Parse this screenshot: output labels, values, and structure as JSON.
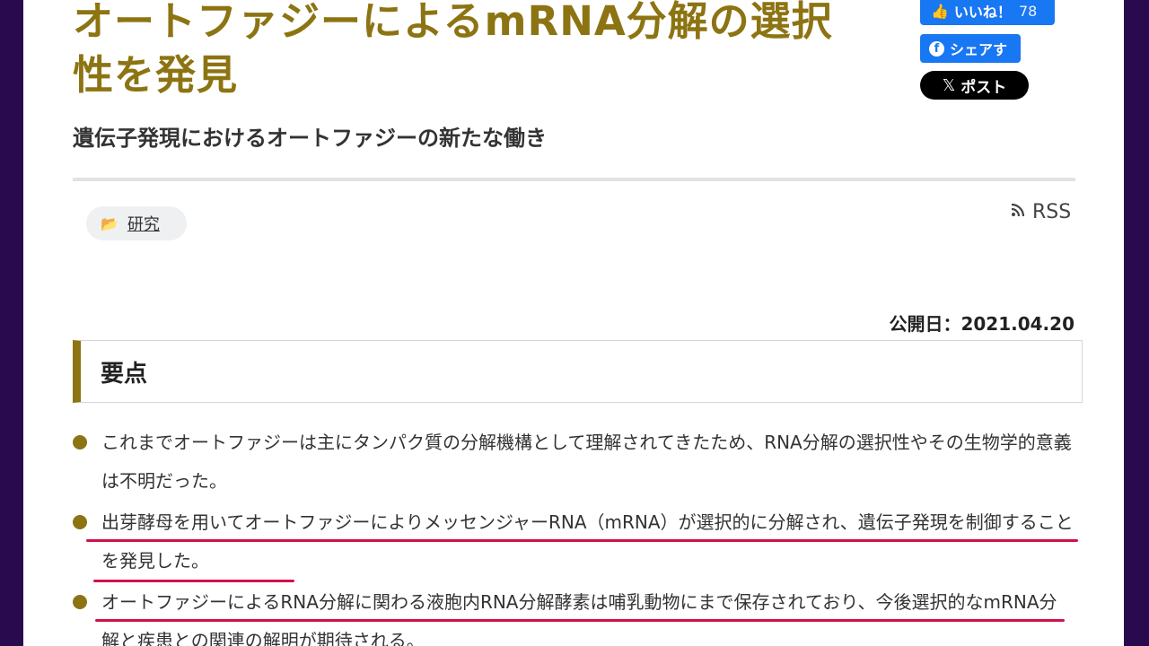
{
  "article": {
    "title": "オートファジーによるmRNA分解の選択性を発見",
    "subtitle": "遺伝子発現におけるオートファジーの新たな働き",
    "category": "研究",
    "rss_label": "RSS",
    "published": "公開日：2021.04.20"
  },
  "social": {
    "like_label": "いいね！",
    "like_count": "78",
    "share_label": "シェアす",
    "post_label": "ポスト"
  },
  "summary": {
    "heading": "要点",
    "points": [
      "これまでオートファジーは主にタンパク質の分解機構として理解されてきたため、RNA分解の選択性やその生物学的意義は不明だった。",
      "出芽酵母を用いてオートファジーによりメッセンジャーRNA（mRNA）が選択的に分解され、遺伝子発現を制御することを発見した。",
      "オートファジーによるRNA分解に関わる液胞内RNA分解酵素は哺乳動物にまで保存されており、今後選択的なmRNA分解と疾患との関連の解明が期待される。"
    ]
  },
  "colors": {
    "accent": "#8d7412",
    "underline": "#d1114b",
    "facebook": "#1877f2",
    "frame": "#2a0a4f"
  }
}
